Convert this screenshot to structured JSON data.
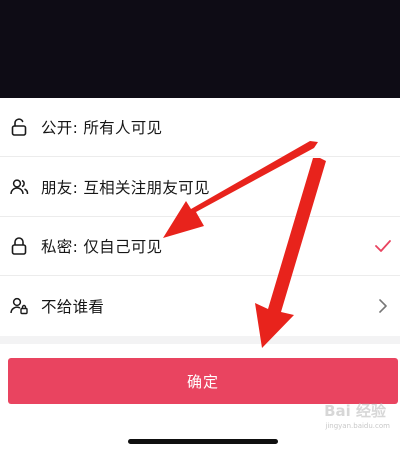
{
  "options": [
    {
      "label": "公开: 所有人可见",
      "icon": "unlock-icon",
      "selected": false
    },
    {
      "label": "朋友: 互相关注朋友可见",
      "icon": "friends-icon",
      "selected": false
    },
    {
      "label": "私密: 仅自己可见",
      "icon": "lock-icon",
      "selected": true
    },
    {
      "label": "不给谁看",
      "icon": "user-block-icon",
      "selected": false,
      "has_chevron": true
    }
  ],
  "confirm_label": "确定",
  "accent_color": "#e94460",
  "annotation_arrow_color": "#e8231c",
  "watermark": {
    "logo_text": "Bai 经验",
    "url_text": "jingyan.baidu.com"
  }
}
